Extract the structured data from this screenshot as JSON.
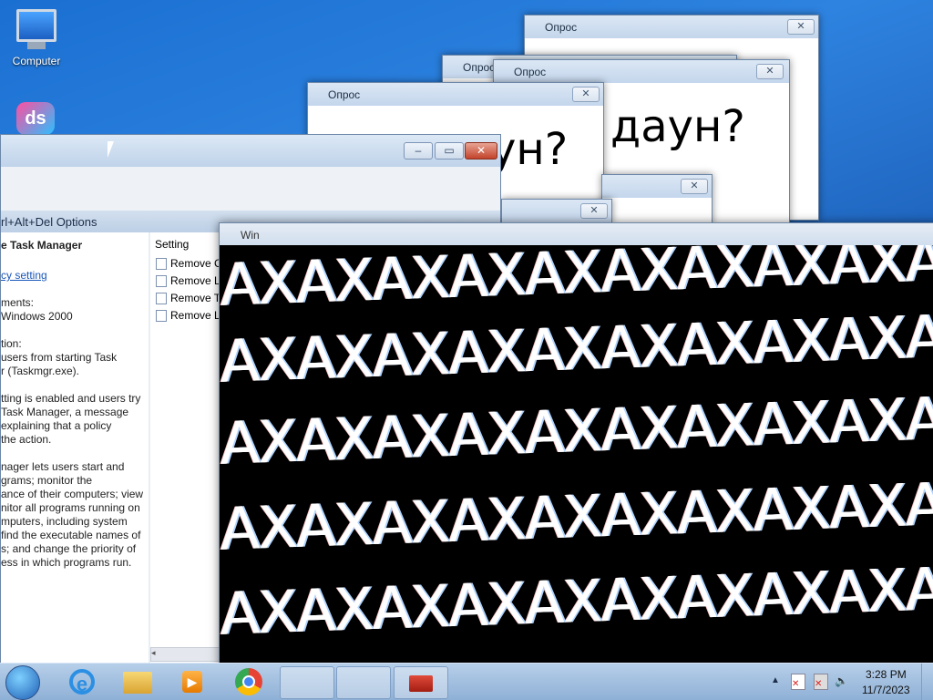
{
  "desktop": {
    "computer_label": "Computer"
  },
  "opros_windows": [
    {
      "title": "Опрос",
      "text": ""
    },
    {
      "title": "Опрос",
      "text": ""
    },
    {
      "title": "Опрос",
      "text": "даун?"
    },
    {
      "title": "Опрос",
      "text": "ун?"
    }
  ],
  "gpedit": {
    "options_header": "rl+Alt+Del Options",
    "policy_title": "e Task Manager",
    "policy_link": "cy setting",
    "req_label": "ments:",
    "req_value": "Windows 2000",
    "desc_label": "tion:",
    "lines": [
      "users from starting Task",
      "r (Taskmgr.exe).",
      "",
      "tting is enabled and users try",
      "Task Manager, a message",
      "explaining that a policy",
      "the action.",
      "",
      "nager lets users start and",
      "grams; monitor the",
      "ance of their computers; view",
      "nitor all programs running on",
      "mputers, including system",
      "find the executable names of",
      "s; and change the priority of",
      "ess in which programs run."
    ],
    "setting_header": "Setting",
    "settings": [
      "Remove C",
      "Remove Lo",
      "Remove Ta",
      "Remove Lo"
    ]
  },
  "hx_window": {
    "title": "Win",
    "rows": [
      "AXAXAXAXAXAXAXAXAXA",
      "AXAXAXAXAXAXAXAXAXA",
      "AXAXAXAXAXAXAXAXAXA",
      "AXAXAXAXAXAXAXAXAXA",
      "AXAXAXAXAXAXAXAXAXA"
    ]
  },
  "taskbar": {
    "time": "3:28 PM",
    "date": "11/7/2023"
  },
  "colors": {
    "desktop": "#1c5fb8",
    "taskbar": "#a3c0e0",
    "close_red": "#c2432b"
  }
}
